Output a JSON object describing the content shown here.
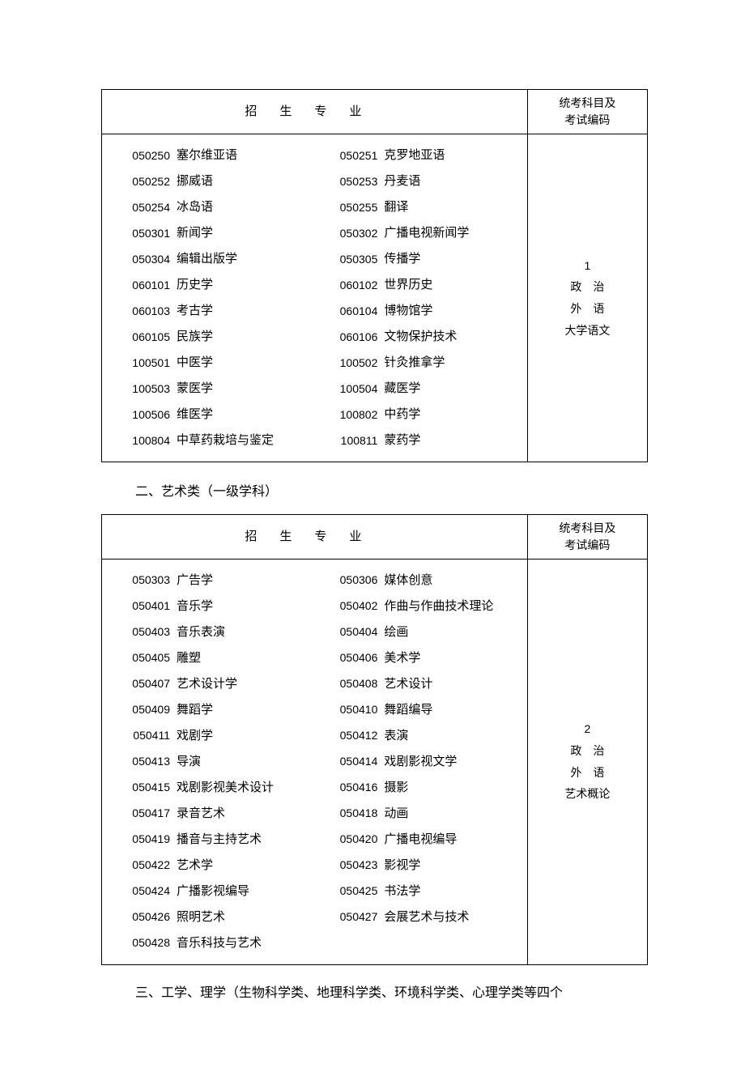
{
  "headers": {
    "major_label": "招生专业",
    "exam_label_l1": "统考科目及",
    "exam_label_l2": "考试编码"
  },
  "table1": {
    "rows": [
      {
        "code": "050250",
        "name": "塞尔维亚语"
      },
      {
        "code": "050251",
        "name": "克罗地亚语"
      },
      {
        "code": "050252",
        "name": "挪威语"
      },
      {
        "code": "050253",
        "name": "丹麦语"
      },
      {
        "code": "050254",
        "name": "冰岛语"
      },
      {
        "code": "050255",
        "name": "翻译"
      },
      {
        "code": "050301",
        "name": "新闻学"
      },
      {
        "code": "050302",
        "name": "广播电视新闻学"
      },
      {
        "code": "050304",
        "name": "编辑出版学"
      },
      {
        "code": "050305",
        "name": "传播学"
      },
      {
        "code": "060101",
        "name": "历史学"
      },
      {
        "code": "060102",
        "name": "世界历史"
      },
      {
        "code": "060103",
        "name": "考古学"
      },
      {
        "code": "060104",
        "name": "博物馆学"
      },
      {
        "code": "060105",
        "name": "民族学"
      },
      {
        "code": "060106",
        "name": "文物保护技术"
      },
      {
        "code": "100501",
        "name": "中医学"
      },
      {
        "code": "100502",
        "name": "针灸推拿学"
      },
      {
        "code": "100503",
        "name": "蒙医学"
      },
      {
        "code": "100504",
        "name": "藏医学"
      },
      {
        "code": "100506",
        "name": "维医学"
      },
      {
        "code": "100802",
        "name": "中药学"
      },
      {
        "code": "100804",
        "name": "中草药栽培与鉴定"
      },
      {
        "code": "100811",
        "name": "蒙药学"
      }
    ],
    "exam": {
      "code": "1",
      "lines": [
        "政　治",
        "外　语",
        "大学语文"
      ]
    }
  },
  "section2_title": "二、艺术类（一级学科）",
  "table2": {
    "rows": [
      {
        "code": "050303",
        "name": "广告学"
      },
      {
        "code": "050306",
        "name": "媒体创意"
      },
      {
        "code": "050401",
        "name": "音乐学"
      },
      {
        "code": "050402",
        "name": "作曲与作曲技术理论"
      },
      {
        "code": "050403",
        "name": "音乐表演"
      },
      {
        "code": "050404",
        "name": "绘画"
      },
      {
        "code": "050405",
        "name": "雕塑"
      },
      {
        "code": "050406",
        "name": "美术学"
      },
      {
        "code": "050407",
        "name": "艺术设计学"
      },
      {
        "code": "050408",
        "name": "艺术设计"
      },
      {
        "code": "050409",
        "name": "舞蹈学"
      },
      {
        "code": "050410",
        "name": "舞蹈编导"
      },
      {
        "code": "050411",
        "name": "戏剧学"
      },
      {
        "code": "050412",
        "name": "表演"
      },
      {
        "code": "050413",
        "name": "导演"
      },
      {
        "code": "050414",
        "name": "戏剧影视文学"
      },
      {
        "code": "050415",
        "name": "戏剧影视美术设计"
      },
      {
        "code": "050416",
        "name": "摄影"
      },
      {
        "code": "050417",
        "name": "录音艺术"
      },
      {
        "code": "050418",
        "name": "动画"
      },
      {
        "code": "050419",
        "name": "播音与主持艺术"
      },
      {
        "code": "050420",
        "name": "广播电视编导"
      },
      {
        "code": "050422",
        "name": "艺术学"
      },
      {
        "code": "050423",
        "name": "影视学"
      },
      {
        "code": "050424",
        "name": "广播影视编导"
      },
      {
        "code": "050425",
        "name": "书法学"
      },
      {
        "code": "050426",
        "name": "照明艺术"
      },
      {
        "code": "050427",
        "name": "会展艺术与技术"
      },
      {
        "code": "050428",
        "name": "音乐科技与艺术"
      }
    ],
    "exam": {
      "code": "2",
      "lines": [
        "政　治",
        "外　语",
        "艺术概论"
      ]
    }
  },
  "section3_para": "三、工学、理学（生物科学类、地理科学类、环境科学类、心理学类等四个"
}
